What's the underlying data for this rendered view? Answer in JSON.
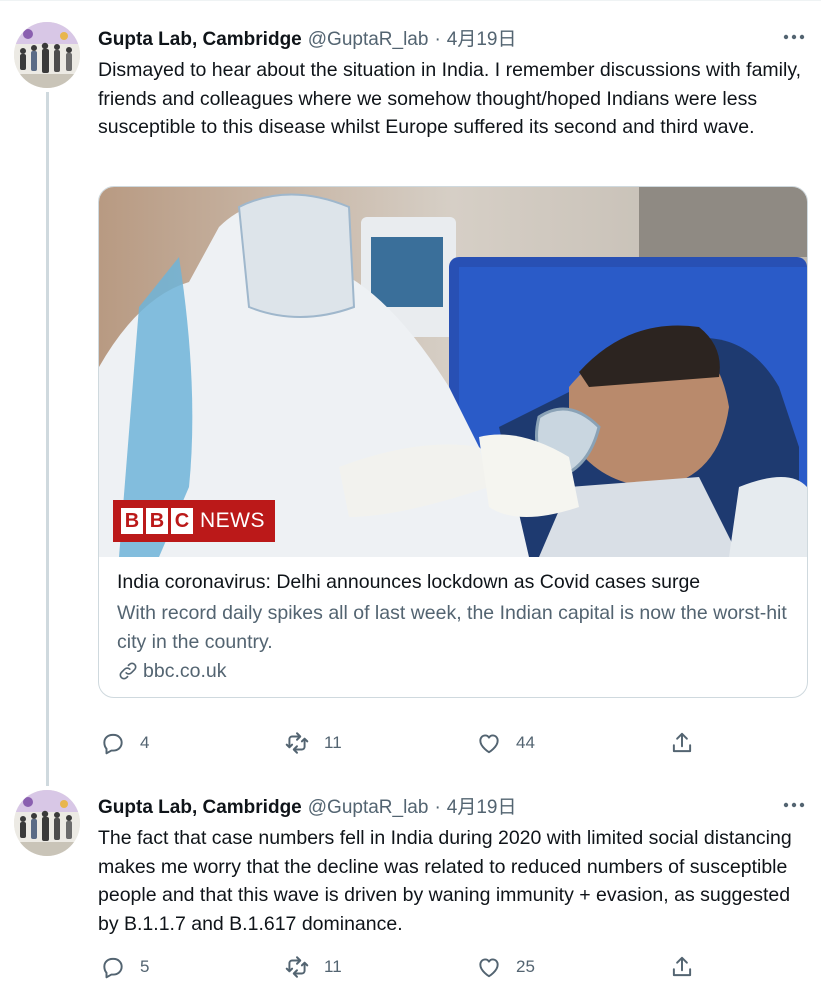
{
  "tweets": [
    {
      "author_name": "Gupta Lab, Cambridge",
      "handle": "@GuptaR_lab",
      "separator": "·",
      "date": "4月19日",
      "text": "Dismayed to hear about the situation in India. I remember discussions with family, friends and colleagues where we somehow thought/hoped Indians were less susceptible to this disease whilst Europe suffered its second and third wave.",
      "card": {
        "image_badge": {
          "letters": [
            "B",
            "B",
            "C"
          ],
          "word": "NEWS"
        },
        "title": "India coronavirus: Delhi announces lockdown as Covid cases surge",
        "description": "With record daily spikes all of last week, the Indian capital is now the worst-hit city in the country.",
        "domain": "bbc.co.uk"
      },
      "actions": {
        "replies": "4",
        "retweets": "11",
        "likes": "44"
      }
    },
    {
      "author_name": "Gupta Lab, Cambridge",
      "handle": "@GuptaR_lab",
      "separator": "·",
      "date": "4月19日",
      "text": "The fact that case numbers fell in India during 2020 with limited social distancing makes me worry that the decline was related to reduced numbers of susceptible people and that this wave is driven by waning immunity + evasion, as suggested by B.1.1.7 and B.1.617 dominance.",
      "actions": {
        "replies": "5",
        "retweets": "11",
        "likes": "25"
      }
    }
  ],
  "icons": [
    "more-icon",
    "reply-icon",
    "retweet-icon",
    "like-icon",
    "share-icon",
    "link-icon"
  ],
  "colors": {
    "text": "#0f1419",
    "secondary": "#536471",
    "border": "#cfd9de",
    "bbc_red": "#bb1919"
  }
}
